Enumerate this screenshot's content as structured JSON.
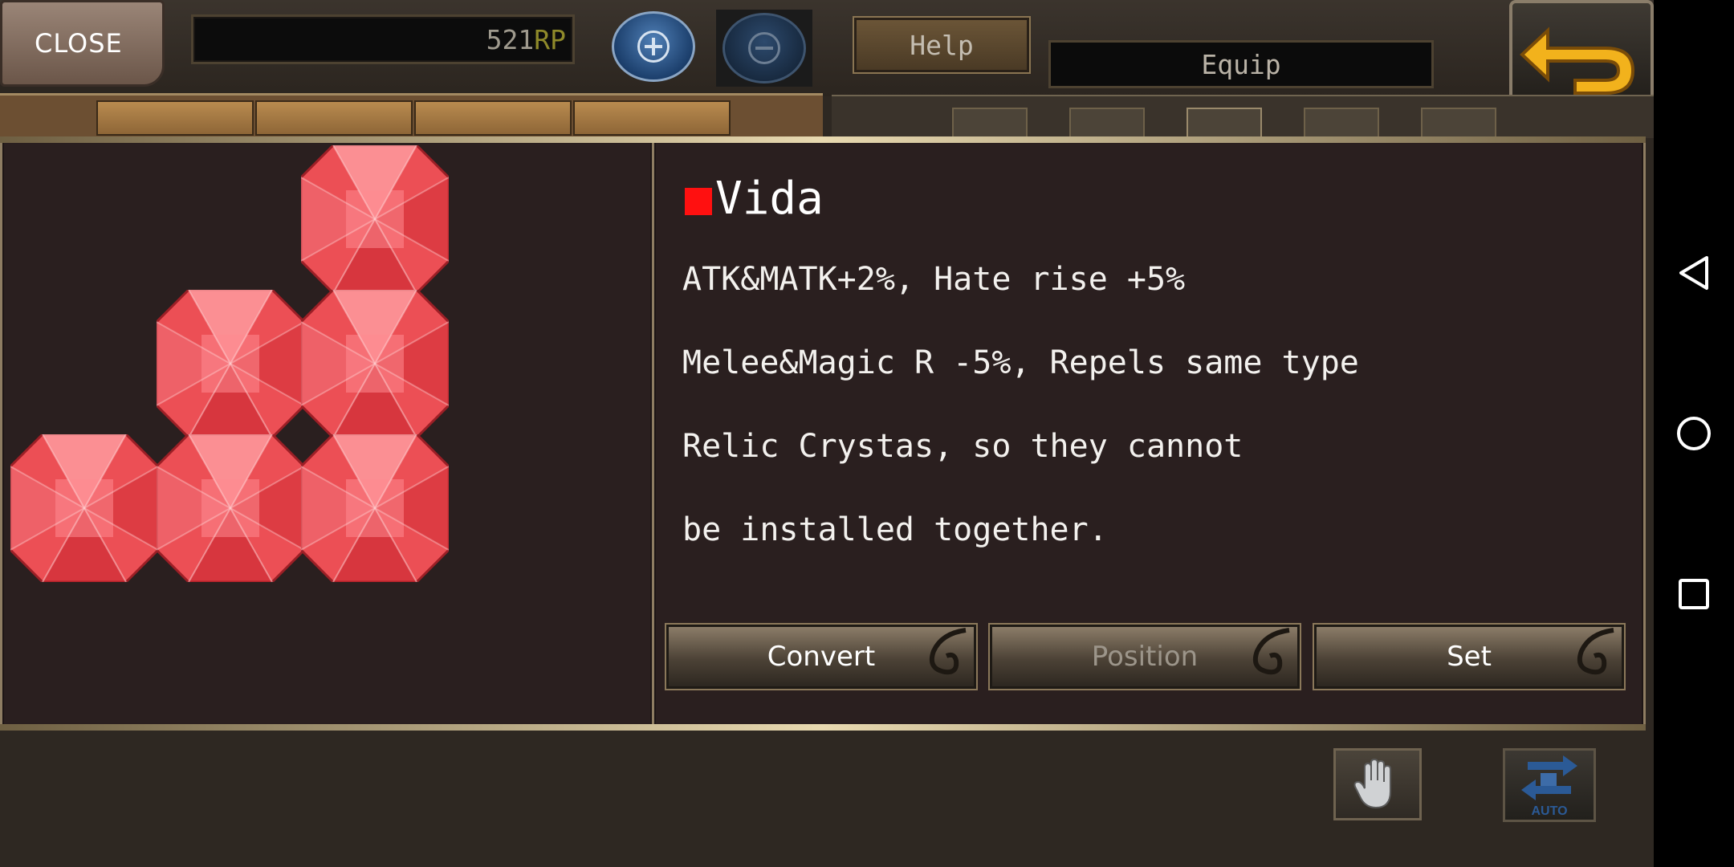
{
  "topbar": {
    "close_label": "CLOSE",
    "rp_value": "521",
    "rp_unit": "RP",
    "help_label": "Help",
    "equip_label": "Equip"
  },
  "detail": {
    "title": "Vida",
    "title_marker_color": "#ff1010",
    "lines": [
      "ATK&MATK+2%, Hate rise +5%",
      "Melee&Magic R -5%, Repels same type",
      "Relic Crystas, so they cannot",
      "be installed together."
    ],
    "buttons": {
      "convert": "Convert",
      "position": "Position",
      "set": "Set"
    }
  },
  "gem_color": "#ec4f55",
  "bottom": {
    "hand_icon": "hand-icon",
    "auto_label": "AUTO"
  },
  "system_nav": {
    "back": "back-triangle-icon",
    "home": "home-circle-icon",
    "recents": "recents-square-icon"
  }
}
